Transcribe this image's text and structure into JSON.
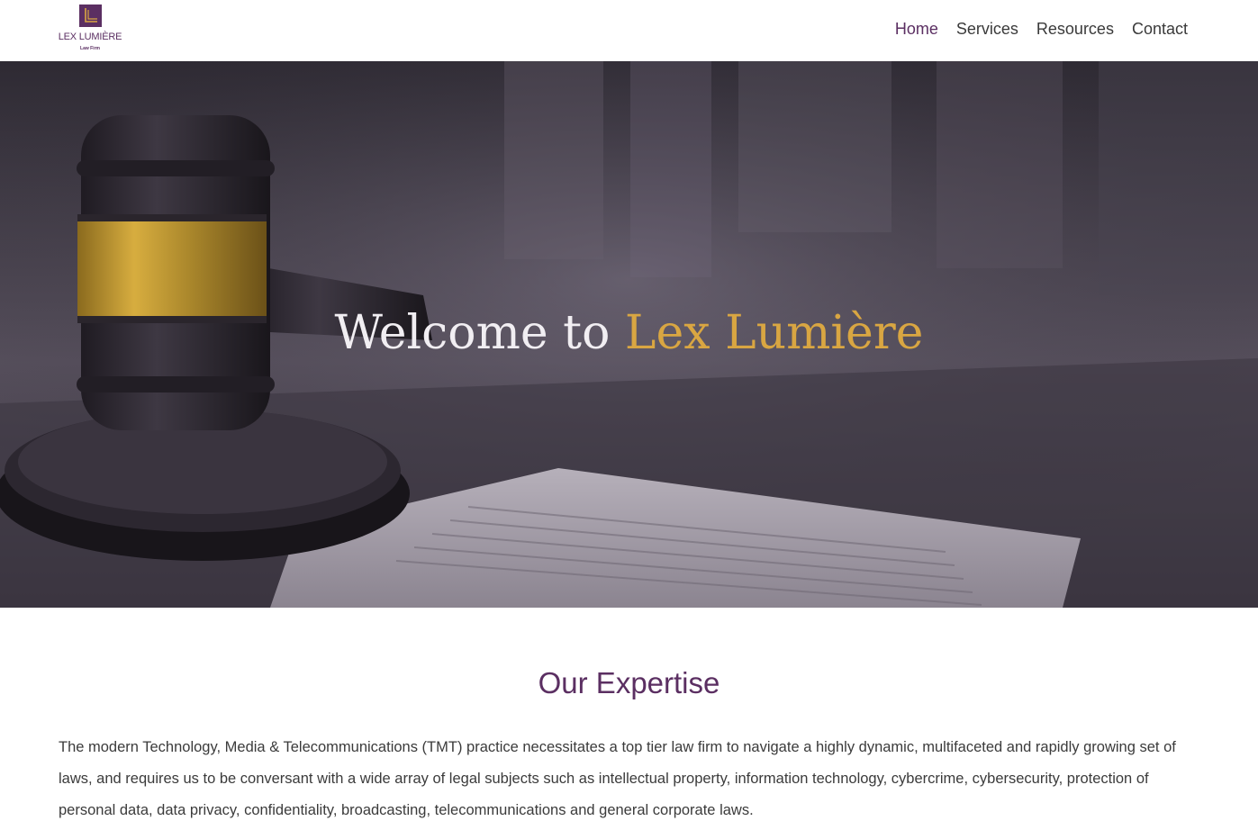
{
  "header": {
    "logo": {
      "icon": "law-firm-logo-icon",
      "title": "LEX LUMIÈRE",
      "subtitle": "Law Firm"
    },
    "nav": [
      {
        "label": "Home",
        "active": true
      },
      {
        "label": "Services",
        "active": false
      },
      {
        "label": "Resources",
        "active": false
      },
      {
        "label": "Contact",
        "active": false
      }
    ]
  },
  "hero": {
    "title_prefix": "Welcome to ",
    "title_accent": "Lex Lumière"
  },
  "expertise": {
    "title": "Our Expertise",
    "body": "The modern Technology, Media & Telecommunications (TMT) practice necessitates a top tier law firm to navigate a highly dynamic, multifaceted and rapidly growing set of laws, and requires us to be conversant with a wide array of legal subjects such as intellectual property, information technology, cybercrime, cybersecurity, protection of personal data, data privacy, confidentiality, broadcasting, telecommunications and general corporate laws."
  },
  "colors": {
    "brand_purple": "#5b2f62",
    "accent_gold": "#d9a642",
    "text_dark": "#3b3b3b"
  }
}
